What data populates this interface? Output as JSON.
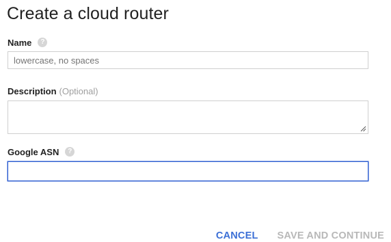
{
  "dialog": {
    "title": "Create a cloud router"
  },
  "name_field": {
    "label": "Name",
    "help_icon": "help-icon",
    "placeholder": "lowercase, no spaces",
    "value": ""
  },
  "description_field": {
    "label": "Description",
    "optional_text": "(Optional)",
    "value": ""
  },
  "asn_field": {
    "label": "Google ASN",
    "help_icon": "help-icon",
    "value": ""
  },
  "actions": {
    "cancel_label": "CANCEL",
    "save_label": "SAVE AND CONTINUE"
  },
  "colors": {
    "accent": "#3b6fd6",
    "focus_border": "#2f5fd1",
    "disabled_text": "#b8b8b8"
  }
}
